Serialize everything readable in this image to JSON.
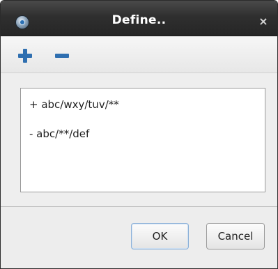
{
  "window": {
    "title": "Define..",
    "close_glyph": "×"
  },
  "toolbar": {
    "add_icon": "plus-icon",
    "remove_icon": "minus-icon",
    "icon_color": "#2f6fb0"
  },
  "list": {
    "items": [
      {
        "text": "+ abc/wxy/tuv/**"
      },
      {
        "text": "- abc/**/def"
      }
    ]
  },
  "buttons": {
    "ok_label": "OK",
    "cancel_label": "Cancel"
  }
}
